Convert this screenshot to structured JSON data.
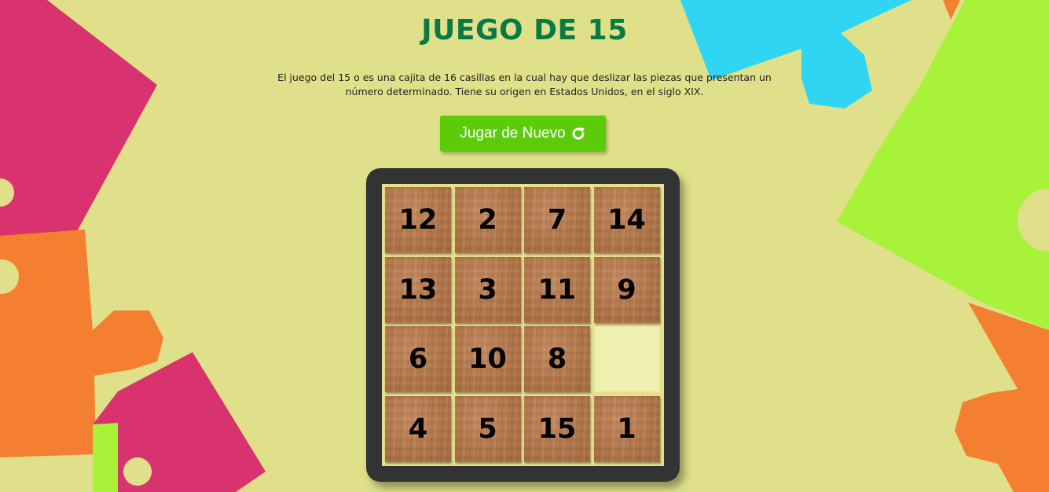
{
  "game": {
    "title": "JUEGO DE 15",
    "description": "El juego del 15 o es una cajita de 16 casillas en la cual hay que deslizar las piezas que presentan un número determinado. Tiene su origen en Estados Unidos, en el siglo XIX.",
    "play_again_label": "Jugar de Nuevo",
    "play_again_icon": "refresh-icon"
  },
  "board": {
    "rows": [
      [
        12,
        2,
        7,
        14
      ],
      [
        13,
        3,
        11,
        9
      ],
      [
        6,
        10,
        8,
        null
      ],
      [
        4,
        5,
        15,
        1
      ]
    ]
  },
  "colors": {
    "background": "#e0e08a",
    "title": "#0a7a44",
    "button": "#5ccc0a",
    "board_frame": "#333333",
    "tile": "#b57a4f",
    "empty_slot": "#f0efb0",
    "puzzle_pink": "#d8336e",
    "puzzle_orange": "#f47f30",
    "puzzle_cyan": "#2fd5f2",
    "puzzle_green": "#a8f23a"
  }
}
